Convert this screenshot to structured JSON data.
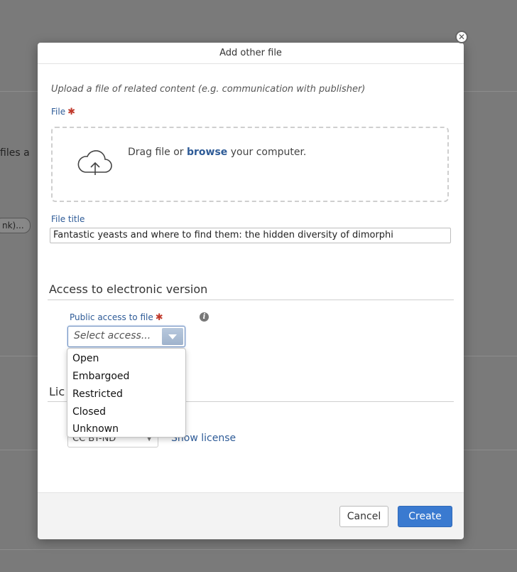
{
  "background": {
    "partial_text": "files a",
    "pill_text": "nk)..."
  },
  "modal": {
    "title": "Add other file",
    "close_symbol": "✕"
  },
  "upload": {
    "intro": "Upload a file of related content (e.g. communication with publisher)",
    "file_label": "File",
    "required_mark": "✱",
    "drop_prefix": "Drag file or ",
    "drop_link": "browse",
    "drop_suffix": " your computer.",
    "icon": "cloud-upload-icon"
  },
  "file_title": {
    "label": "File title",
    "value": "Fantastic yeasts and where to find them: the hidden diversity of dimorphi"
  },
  "access": {
    "section_title": "Access to electronic version",
    "public_access_label": "Public access to file",
    "required_mark": "✱",
    "info_icon": "i",
    "select_placeholder": "Select access...",
    "options": [
      "Open",
      "Embargoed",
      "Restricted",
      "Closed",
      "Unknown"
    ]
  },
  "license": {
    "section_title_partial": "Lic",
    "select_value": "CC BY-ND",
    "show_license": "Show license"
  },
  "footer": {
    "cancel_label": "Cancel",
    "create_label": "Create"
  },
  "colors": {
    "link": "#2e5b97",
    "primary_button": "#3a7ad0",
    "required": "#c0392b",
    "overlay": "#7a7a7a"
  }
}
